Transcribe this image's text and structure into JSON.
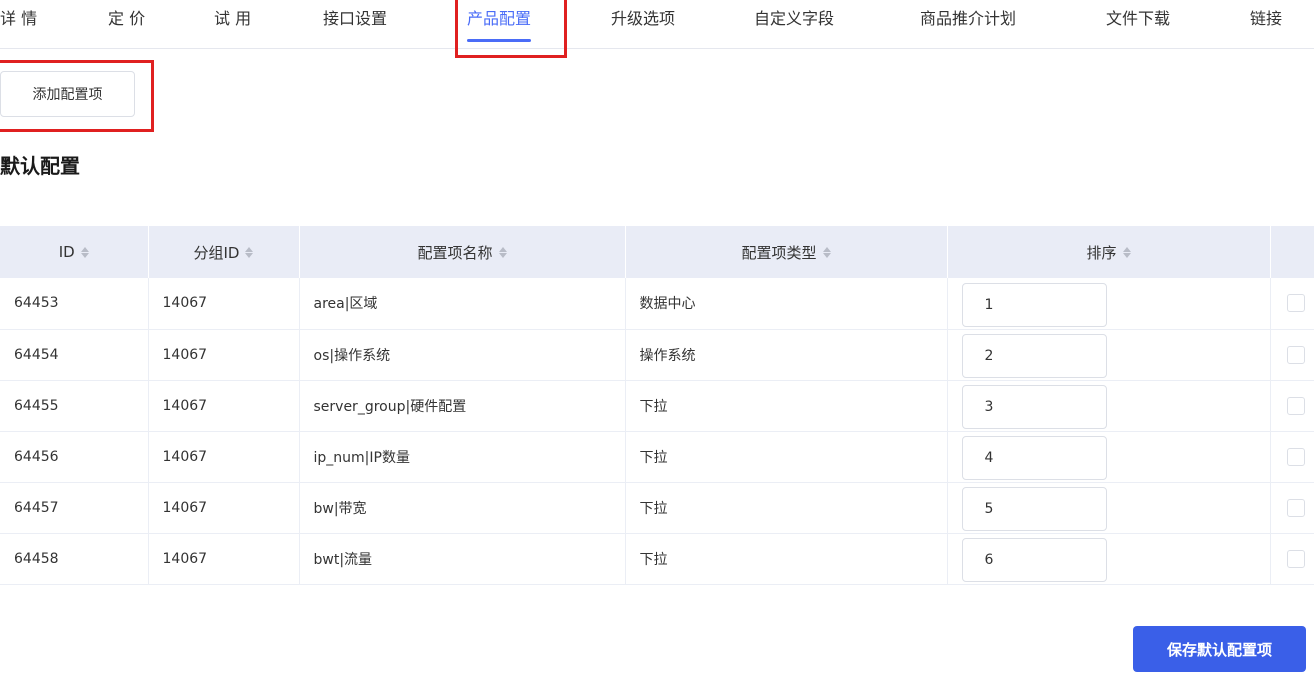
{
  "tabs": [
    {
      "label": "详 情",
      "active": false
    },
    {
      "label": "定 价",
      "active": false
    },
    {
      "label": "试 用",
      "active": false
    },
    {
      "label": "接口设置",
      "active": false
    },
    {
      "label": "产品配置",
      "active": true
    },
    {
      "label": "升级选项",
      "active": false
    },
    {
      "label": "自定义字段",
      "active": false
    },
    {
      "label": "商品推介计划",
      "active": false
    },
    {
      "label": "文件下载",
      "active": false
    },
    {
      "label": "链接",
      "active": false
    }
  ],
  "add_button_label": "添加配置项",
  "section_title": "默认配置",
  "table": {
    "headers": [
      "ID",
      "分组ID",
      "配置项名称",
      "配置项类型",
      "排序"
    ],
    "rows": [
      {
        "id": "64453",
        "group_id": "14067",
        "name": "area|区域",
        "type": "数据中心",
        "sort": "1"
      },
      {
        "id": "64454",
        "group_id": "14067",
        "name": "os|操作系统",
        "type": "操作系统",
        "sort": "2"
      },
      {
        "id": "64455",
        "group_id": "14067",
        "name": "server_group|硬件配置",
        "type": "下拉",
        "sort": "3"
      },
      {
        "id": "64456",
        "group_id": "14067",
        "name": "ip_num|IP数量",
        "type": "下拉",
        "sort": "4"
      },
      {
        "id": "64457",
        "group_id": "14067",
        "name": "bw|带宽",
        "type": "下拉",
        "sort": "5"
      },
      {
        "id": "64458",
        "group_id": "14067",
        "name": "bwt|流量",
        "type": "下拉",
        "sort": "6"
      }
    ]
  },
  "save_button_label": "保存默认配置项",
  "colors": {
    "accent": "#4a6cf7",
    "primary_button": "#3a5fe8",
    "highlight": "#e02020",
    "header_bg": "#e9ecf6"
  }
}
